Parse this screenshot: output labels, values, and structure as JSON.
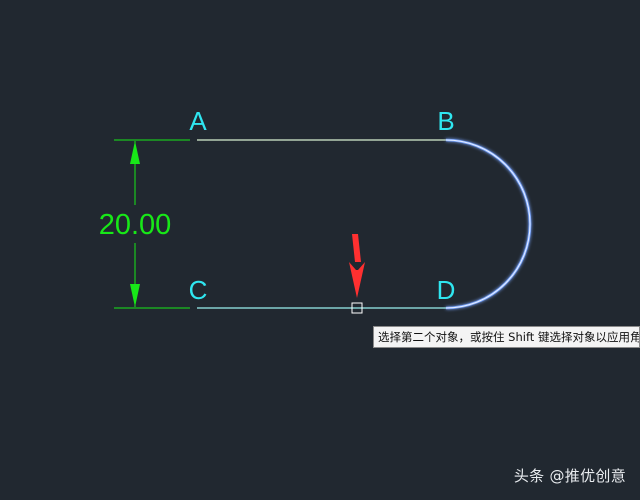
{
  "points": {
    "a": "A",
    "b": "B",
    "c": "C",
    "d": "D"
  },
  "dimension": {
    "value": "20.00"
  },
  "tooltip": {
    "text": "选择第二个对象，或按住 Shift 键选择对象以应用角"
  },
  "watermark": {
    "text": "头条 @推优创意"
  },
  "colors": {
    "background": "#212830",
    "point_label": "#2fe6f0",
    "dimension": "#18e818",
    "line_glow": "#2ad0d8",
    "arc": "#c9d8ff",
    "arrow": "#ff3030"
  }
}
